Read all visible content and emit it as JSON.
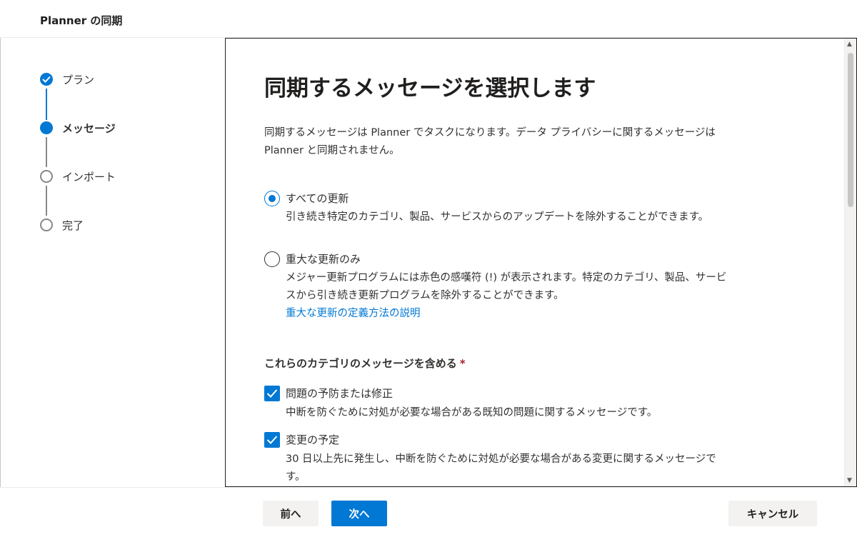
{
  "window": {
    "title": "Planner の同期"
  },
  "steps": [
    {
      "label": "プラン",
      "state": "done"
    },
    {
      "label": "メッセージ",
      "state": "current"
    },
    {
      "label": "インポート",
      "state": "pending"
    },
    {
      "label": "完了",
      "state": "pending"
    }
  ],
  "main": {
    "heading": "同期するメッセージを選択します",
    "description": "同期するメッセージは Planner でタスクになります。データ プライバシーに関するメッセージは Planner と同期されません。",
    "options": [
      {
        "title": "すべての更新",
        "description": "引き続き特定のカテゴリ、製品、サービスからのアップデートを除外することができます。",
        "selected": true
      },
      {
        "title": "重大な更新のみ",
        "description": "メジャー更新プログラムには赤色の感嘆符 (!) が表示されます。特定のカテゴリ、製品、サービスから引き続き更新プログラムを除外することができます。",
        "link": "重大な更新の定義方法の説明",
        "selected": false
      }
    ],
    "categories_title": "これらのカテゴリのメッセージを含める",
    "required_marker": "*",
    "categories": [
      {
        "title": "問題の予防または修正",
        "description": "中断を防ぐために対処が必要な場合がある既知の問題に関するメッセージです。",
        "checked": true
      },
      {
        "title": "変更の予定",
        "description": "30 日以上先に発生し、中断を防ぐために対処が必要な場合がある変更に関するメッセージです。",
        "checked": true
      }
    ]
  },
  "footer": {
    "back_label": "前へ",
    "next_label": "次へ",
    "cancel_label": "キャンセル"
  },
  "colors": {
    "accent": "#0078d4",
    "required": "#a4262c"
  }
}
